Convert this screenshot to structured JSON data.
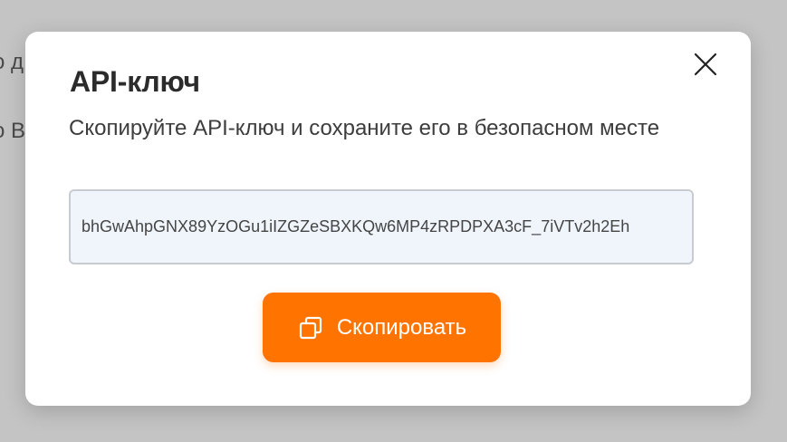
{
  "background": {
    "line_1": "о д",
    "line_2": "о В"
  },
  "modal": {
    "title": "API-ключ",
    "description": "Скопируйте API-ключ и сохраните его в безопасном месте",
    "api_key_value": "bhGwAhpGNX89YzOGu1iIZGZeSBXKQw6MP4zRPDPXA3cF_7iVTv2h2Eh",
    "copy_button_label": "Скопировать",
    "close_icon": "close-icon",
    "copy_icon": "copy-icon"
  },
  "colors": {
    "accent": "#ff7300",
    "input_background": "#f0f5fb",
    "overlay": "#c4c4c4"
  }
}
